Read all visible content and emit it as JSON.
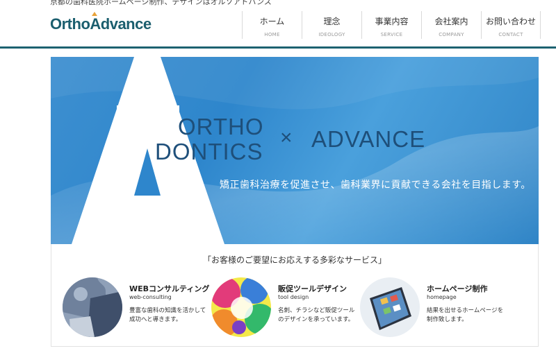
{
  "header": {
    "tagline": "京都の歯科医院ホームページ制作、デザインはオルソアドバンス",
    "logo": "OrthoAdvance"
  },
  "nav": [
    {
      "jp": "ホーム",
      "en": "HOME"
    },
    {
      "jp": "理念",
      "en": "IDEOLOGY"
    },
    {
      "jp": "事業内容",
      "en": "SERVICE"
    },
    {
      "jp": "会社案内",
      "en": "COMPANY"
    },
    {
      "jp": "お問い合わせ",
      "en": "CONTACT"
    }
  ],
  "hero": {
    "line1": "ORTHO",
    "line2": "DONTICS",
    "times": "×",
    "advance": "ADVANCE",
    "subtitle": "矯正歯科治療を促進させ、歯科業界に貢献できる会社を目指します。"
  },
  "services": {
    "title": "「お客様のご要望にお応えする多彩なサービス」",
    "items": [
      {
        "title": "WEBコンサルティング",
        "en": "web-consulting",
        "desc": "豊富な歯科の知識を活かして成功へと導きます。"
      },
      {
        "title": "販促ツールデザイン",
        "en": "tool design",
        "desc": "名刺、チラシなど販促ツールのデザインを承っています。"
      },
      {
        "title": "ホームページ制作",
        "en": "homepage",
        "desc": "結果を出せるホームページを制作致します。"
      }
    ]
  },
  "colors": {
    "brand": "#1b5e6e",
    "header_line": "#1d6270",
    "hero_blue": "#2e86cc",
    "logo_accent": "#e8a23a"
  }
}
